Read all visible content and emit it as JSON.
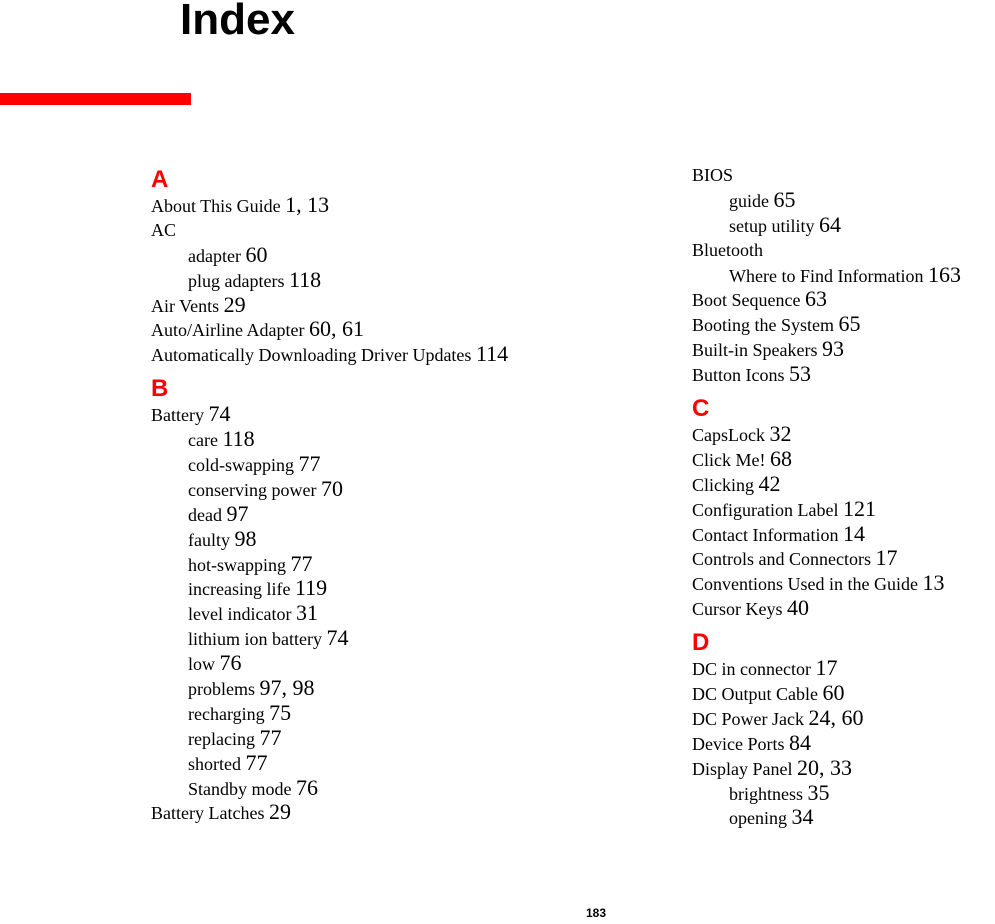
{
  "page": {
    "title": "Index",
    "page_number": "183",
    "accent_color": "#ff0000"
  },
  "left_column": {
    "sections": [
      {
        "letter": "A",
        "entries": [
          {
            "term": "About This Guide",
            "pages": "1, 13",
            "level": 0
          },
          {
            "term": "AC",
            "pages": "",
            "level": 0
          },
          {
            "term": "adapter",
            "pages": "60",
            "level": 1
          },
          {
            "term": "plug adapters",
            "pages": "118",
            "level": 1
          },
          {
            "term": "Air Vents",
            "pages": "29",
            "level": 0
          },
          {
            "term": "Auto/Airline Adapter",
            "pages": "60, 61",
            "level": 0
          },
          {
            "term": "Automatically Downloading Driver Updates",
            "pages": "114",
            "level": 0
          }
        ]
      },
      {
        "letter": "B",
        "entries": [
          {
            "term": "Battery",
            "pages": "74",
            "level": 0
          },
          {
            "term": "care",
            "pages": "118",
            "level": 1
          },
          {
            "term": "cold-swapping",
            "pages": "77",
            "level": 1
          },
          {
            "term": "conserving power",
            "pages": "70",
            "level": 1
          },
          {
            "term": "dead",
            "pages": "97",
            "level": 1
          },
          {
            "term": "faulty",
            "pages": "98",
            "level": 1
          },
          {
            "term": "hot-swapping",
            "pages": "77",
            "level": 1
          },
          {
            "term": "increasing life",
            "pages": "119",
            "level": 1
          },
          {
            "term": "level indicator",
            "pages": "31",
            "level": 1
          },
          {
            "term": "lithium ion battery",
            "pages": "74",
            "level": 1
          },
          {
            "term": "low",
            "pages": "76",
            "level": 1
          },
          {
            "term": "problems",
            "pages": "97, 98",
            "level": 1
          },
          {
            "term": "recharging",
            "pages": "75",
            "level": 1
          },
          {
            "term": "replacing",
            "pages": "77",
            "level": 1
          },
          {
            "term": "shorted",
            "pages": "77",
            "level": 1
          },
          {
            "term": "Standby mode",
            "pages": "76",
            "level": 1
          },
          {
            "term": "Battery Latches",
            "pages": "29",
            "level": 0
          }
        ]
      }
    ]
  },
  "right_column": {
    "sections": [
      {
        "letter": "",
        "entries": [
          {
            "term": "BIOS",
            "pages": "",
            "level": 0
          },
          {
            "term": "guide",
            "pages": "65",
            "level": 1
          },
          {
            "term": "setup utility",
            "pages": "64",
            "level": 1
          },
          {
            "term": "Bluetooth",
            "pages": "",
            "level": 0
          },
          {
            "term": "Where to Find Information",
            "pages": "163",
            "level": 1
          },
          {
            "term": "Boot Sequence",
            "pages": "63",
            "level": 0
          },
          {
            "term": "Booting the System",
            "pages": "65",
            "level": 0
          },
          {
            "term": "Built-in Speakers",
            "pages": "93",
            "level": 0
          },
          {
            "term": "Button Icons",
            "pages": "53",
            "level": 0
          }
        ]
      },
      {
        "letter": "C",
        "entries": [
          {
            "term": "CapsLock",
            "pages": "32",
            "level": 0
          },
          {
            "term": "Click Me!",
            "pages": "68",
            "level": 0
          },
          {
            "term": "Clicking",
            "pages": "42",
            "level": 0
          },
          {
            "term": "Configuration Label",
            "pages": "121",
            "level": 0
          },
          {
            "term": "Contact Information",
            "pages": "14",
            "level": 0
          },
          {
            "term": "Controls and Connectors",
            "pages": "17",
            "level": 0
          },
          {
            "term": "Conventions Used in the Guide",
            "pages": "13",
            "level": 0
          },
          {
            "term": "Cursor Keys",
            "pages": "40",
            "level": 0
          }
        ]
      },
      {
        "letter": "D",
        "entries": [
          {
            "term": "DC in connector",
            "pages": "17",
            "level": 0
          },
          {
            "term": "DC Output Cable",
            "pages": "60",
            "level": 0
          },
          {
            "term": "DC Power Jack",
            "pages": "24, 60",
            "level": 0
          },
          {
            "term": "Device Ports",
            "pages": "84",
            "level": 0
          },
          {
            "term": "Display Panel",
            "pages": "20, 33",
            "level": 0
          },
          {
            "term": "brightness",
            "pages": "35",
            "level": 1
          },
          {
            "term": "opening",
            "pages": "34",
            "level": 1
          }
        ]
      }
    ]
  }
}
